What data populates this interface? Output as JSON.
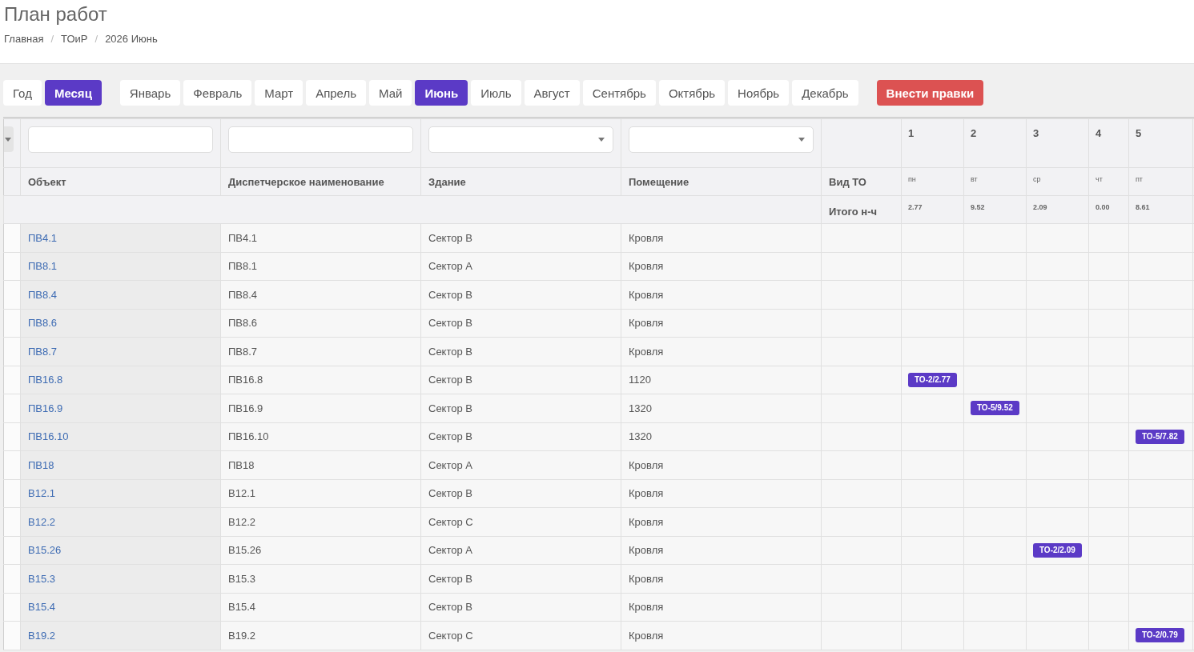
{
  "page": {
    "title": "План работ",
    "breadcrumb": [
      {
        "kind": "link",
        "label": "Главная"
      },
      {
        "kind": "separator",
        "label": "/"
      },
      {
        "kind": "link",
        "label": "ТОиР"
      },
      {
        "kind": "separator",
        "label": "/"
      },
      {
        "kind": "current",
        "label": "2026 Июнь"
      }
    ]
  },
  "view_toggle": [
    {
      "label": "Год",
      "selected": false
    },
    {
      "label": "Месяц",
      "selected": true
    }
  ],
  "months": [
    {
      "label": "Январь",
      "selected": false
    },
    {
      "label": "Февраль",
      "selected": false
    },
    {
      "label": "Март",
      "selected": false
    },
    {
      "label": "Апрель",
      "selected": false
    },
    {
      "label": "Май",
      "selected": false
    },
    {
      "label": "Июнь",
      "selected": true
    },
    {
      "label": "Июль",
      "selected": false
    },
    {
      "label": "Август",
      "selected": false
    },
    {
      "label": "Сентябрь",
      "selected": false
    },
    {
      "label": "Октябрь",
      "selected": false
    },
    {
      "label": "Ноябрь",
      "selected": false
    },
    {
      "label": "Декабрь",
      "selected": false
    }
  ],
  "action_button": "Внести правки",
  "table": {
    "filters": [
      {
        "kind": "text"
      },
      {
        "kind": "text"
      },
      {
        "kind": "select"
      },
      {
        "kind": "select"
      }
    ],
    "columns": [
      "Объект",
      "Диспетчерское наименование",
      "Здание",
      "Помещение",
      "Вид ТО"
    ],
    "totals_label": "Итого н-ч",
    "days": [
      {
        "number": "1",
        "weekday": "пн",
        "total": "2.77"
      },
      {
        "number": "2",
        "weekday": "вт",
        "total": "9.52"
      },
      {
        "number": "3",
        "weekday": "ср",
        "total": "2.09"
      },
      {
        "number": "4",
        "weekday": "чт",
        "total": "0.00"
      },
      {
        "number": "5",
        "weekday": "пт",
        "total": "8.61"
      }
    ],
    "rows": [
      {
        "object": "ПВ4.1",
        "name": "ПВ4.1",
        "building": "Сектор В",
        "room": "Кровля",
        "days": [
          {
            "kind": "empty"
          },
          {
            "kind": "empty"
          },
          {
            "kind": "empty"
          },
          {
            "kind": "empty"
          },
          {
            "kind": "empty"
          }
        ]
      },
      {
        "object": "ПВ8.1",
        "name": "ПВ8.1",
        "building": "Сектор А",
        "room": "Кровля",
        "days": [
          {
            "kind": "empty"
          },
          {
            "kind": "empty"
          },
          {
            "kind": "empty"
          },
          {
            "kind": "empty"
          },
          {
            "kind": "empty"
          }
        ]
      },
      {
        "object": "ПВ8.4",
        "name": "ПВ8.4",
        "building": "Сектор В",
        "room": "Кровля",
        "days": [
          {
            "kind": "empty"
          },
          {
            "kind": "empty"
          },
          {
            "kind": "empty"
          },
          {
            "kind": "empty"
          },
          {
            "kind": "empty"
          }
        ]
      },
      {
        "object": "ПВ8.6",
        "name": "ПВ8.6",
        "building": "Сектор В",
        "room": "Кровля",
        "days": [
          {
            "kind": "empty"
          },
          {
            "kind": "empty"
          },
          {
            "kind": "empty"
          },
          {
            "kind": "empty"
          },
          {
            "kind": "empty"
          }
        ]
      },
      {
        "object": "ПВ8.7",
        "name": "ПВ8.7",
        "building": "Сектор В",
        "room": "Кровля",
        "days": [
          {
            "kind": "empty"
          },
          {
            "kind": "empty"
          },
          {
            "kind": "empty"
          },
          {
            "kind": "empty"
          },
          {
            "kind": "empty"
          }
        ]
      },
      {
        "object": "ПВ16.8",
        "name": "ПВ16.8",
        "building": "Сектор В",
        "room": "1120",
        "days": [
          {
            "kind": "task",
            "label": "ТО-2/2.77"
          },
          {
            "kind": "empty"
          },
          {
            "kind": "empty"
          },
          {
            "kind": "empty"
          },
          {
            "kind": "empty"
          }
        ]
      },
      {
        "object": "ПВ16.9",
        "name": "ПВ16.9",
        "building": "Сектор В",
        "room": "1320",
        "days": [
          {
            "kind": "empty"
          },
          {
            "kind": "task",
            "label": "ТО-5/9.52"
          },
          {
            "kind": "empty"
          },
          {
            "kind": "empty"
          },
          {
            "kind": "empty"
          }
        ]
      },
      {
        "object": "ПВ16.10",
        "name": "ПВ16.10",
        "building": "Сектор В",
        "room": "1320",
        "days": [
          {
            "kind": "empty"
          },
          {
            "kind": "empty"
          },
          {
            "kind": "empty"
          },
          {
            "kind": "empty"
          },
          {
            "kind": "task",
            "label": "ТО-5/7.82"
          }
        ]
      },
      {
        "object": "ПВ18",
        "name": "ПВ18",
        "building": "Сектор А",
        "room": "Кровля",
        "days": [
          {
            "kind": "empty"
          },
          {
            "kind": "empty"
          },
          {
            "kind": "empty"
          },
          {
            "kind": "empty"
          },
          {
            "kind": "empty"
          }
        ]
      },
      {
        "object": "В12.1",
        "name": "В12.1",
        "building": "Сектор В",
        "room": "Кровля",
        "days": [
          {
            "kind": "empty"
          },
          {
            "kind": "empty"
          },
          {
            "kind": "empty"
          },
          {
            "kind": "empty"
          },
          {
            "kind": "empty"
          }
        ]
      },
      {
        "object": "В12.2",
        "name": "В12.2",
        "building": "Сектор С",
        "room": "Кровля",
        "days": [
          {
            "kind": "empty"
          },
          {
            "kind": "empty"
          },
          {
            "kind": "empty"
          },
          {
            "kind": "empty"
          },
          {
            "kind": "empty"
          }
        ]
      },
      {
        "object": "В15.26",
        "name": "В15.26",
        "building": "Сектор А",
        "room": "Кровля",
        "days": [
          {
            "kind": "empty"
          },
          {
            "kind": "empty"
          },
          {
            "kind": "task",
            "label": "ТО-2/2.09"
          },
          {
            "kind": "empty"
          },
          {
            "kind": "empty"
          }
        ]
      },
      {
        "object": "В15.3",
        "name": "В15.3",
        "building": "Сектор В",
        "room": "Кровля",
        "days": [
          {
            "kind": "empty"
          },
          {
            "kind": "empty"
          },
          {
            "kind": "empty"
          },
          {
            "kind": "empty"
          },
          {
            "kind": "empty"
          }
        ]
      },
      {
        "object": "В15.4",
        "name": "В15.4",
        "building": "Сектор В",
        "room": "Кровля",
        "days": [
          {
            "kind": "empty"
          },
          {
            "kind": "empty"
          },
          {
            "kind": "empty"
          },
          {
            "kind": "empty"
          },
          {
            "kind": "empty"
          }
        ]
      },
      {
        "object": "В19.2",
        "name": "В19.2",
        "building": "Сектор С",
        "room": "Кровля",
        "days": [
          {
            "kind": "empty"
          },
          {
            "kind": "empty"
          },
          {
            "kind": "empty"
          },
          {
            "kind": "empty"
          },
          {
            "kind": "task",
            "label": "ТО-2/0.79"
          }
        ]
      }
    ]
  }
}
